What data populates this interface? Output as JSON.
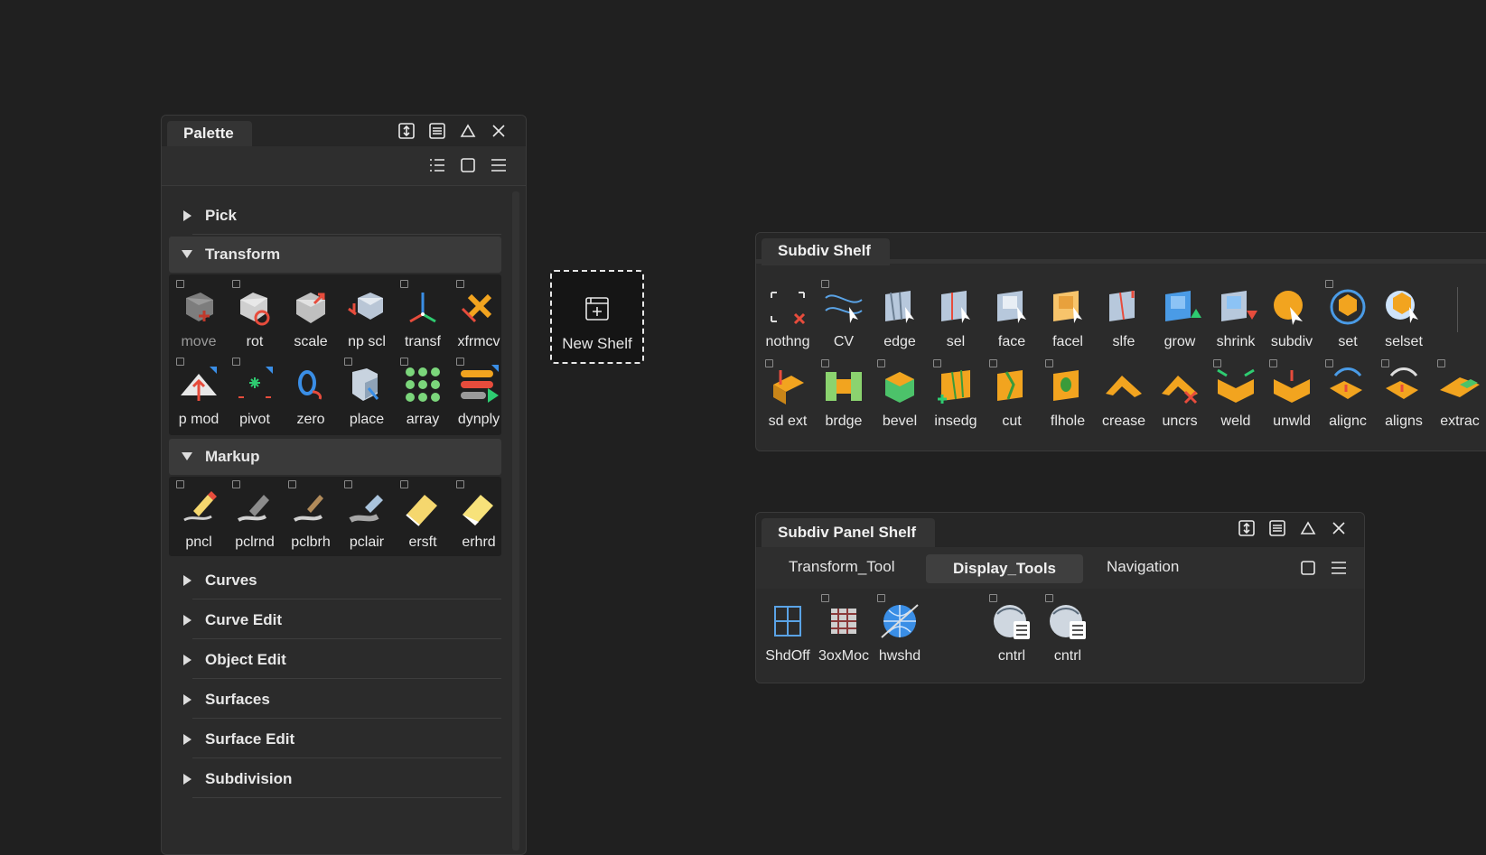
{
  "palette": {
    "title": "Palette",
    "sections_top": [
      {
        "label": "Pick"
      }
    ],
    "transform": {
      "label": "Transform",
      "row1": [
        "move",
        "rot",
        "scale",
        "np scl",
        "transf",
        "xfrmcv"
      ],
      "row2": [
        "p mod",
        "pivot",
        "zero",
        "place",
        "array",
        "dynply"
      ]
    },
    "markup": {
      "label": "Markup",
      "row1": [
        "pncl",
        "pclrnd",
        "pclbrh",
        "pclair",
        "ersft",
        "erhrd"
      ]
    },
    "sections_bottom": [
      "Curves",
      "Curve Edit",
      "Object Edit",
      "Surfaces",
      "Surface Edit",
      "Subdivision"
    ]
  },
  "new_shelf": {
    "label": "New Shelf"
  },
  "subdiv_shelf": {
    "title": "Subdiv Shelf",
    "row1": [
      "nothng",
      "CV",
      "edge",
      "sel",
      "face",
      "facel",
      "slfe",
      "grow",
      "shrink",
      "subdiv",
      "set",
      "selset"
    ],
    "row2": [
      "sd ext",
      "brdge",
      "bevel",
      "insedg",
      "cut",
      "flhole",
      "crease",
      "uncrs",
      "weld",
      "unwld",
      "alignc",
      "aligns",
      "extrac"
    ]
  },
  "subdiv_panel_shelf": {
    "title": "Subdiv Panel Shelf",
    "tabs": [
      "Transform_Tool",
      "Display_Tools",
      "Navigation"
    ],
    "active_tab": "Display_Tools",
    "items": [
      "ShdOff",
      "3oxMoc",
      "hwshd",
      "cntrl",
      "cntrl"
    ]
  },
  "colors": {
    "accent": "#f2a41f",
    "bg": "#202020",
    "panel": "#2b2b2b"
  }
}
